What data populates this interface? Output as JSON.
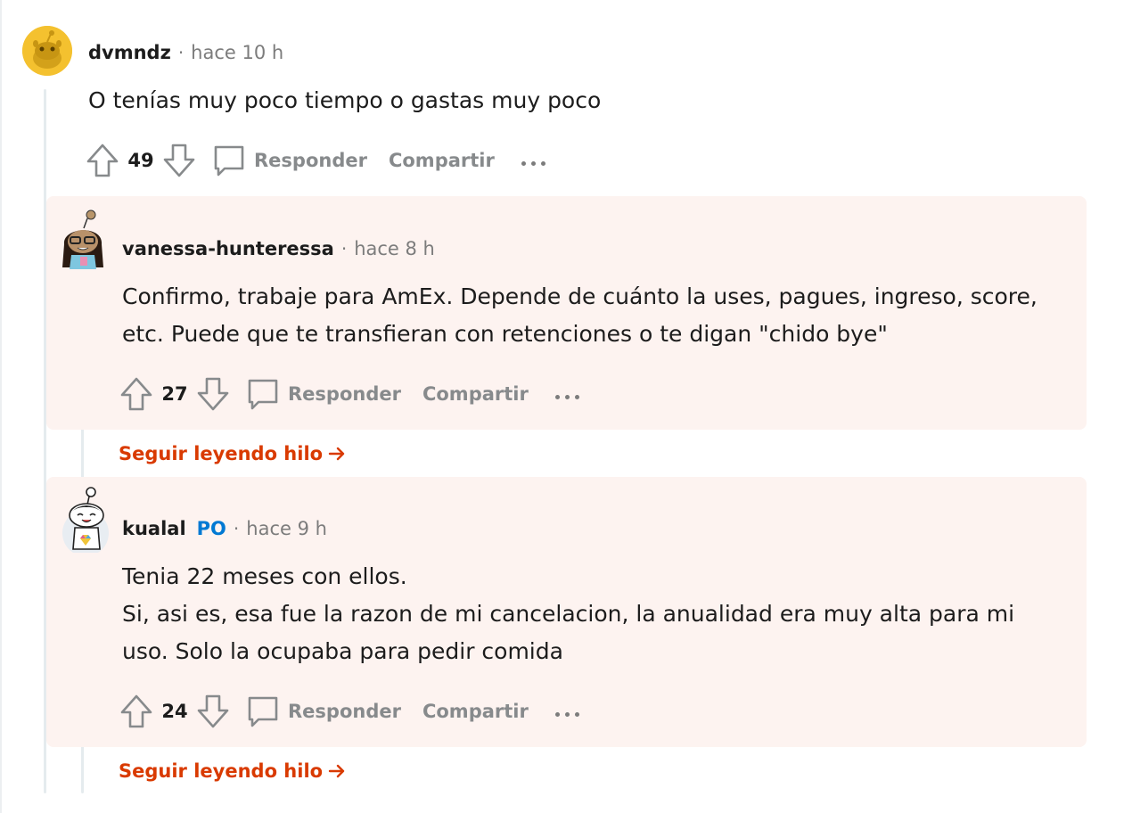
{
  "comments": [
    {
      "username": "dvmndz",
      "time": "hace 10 h",
      "body": [
        "O tenías muy poco tiempo o gastas muy poco"
      ],
      "score": "49"
    },
    {
      "username": "vanessa-hunteressa",
      "time": "hace 8 h",
      "body": [
        "Confirmo, trabaje para AmEx. Depende de cuánto la uses, pagues, ingreso, score,",
        "etc. Puede que te transfieran con retenciones o te digan \"chido bye\""
      ],
      "score": "27",
      "continue_label": "Seguir leyendo hilo"
    },
    {
      "username": "kualal",
      "op_badge": "PO",
      "time": "hace 9 h",
      "body": [
        "Tenia 22 meses con ellos.",
        "Si, asi es, esa fue la razon de mi cancelacion, la anualidad era muy alta para mi",
        "uso. Solo la ocupaba para pedir comida"
      ],
      "score": "24",
      "continue_label": "Seguir leyendo hilo"
    }
  ],
  "actions": {
    "reply_label": "Responder",
    "share_label": "Compartir"
  },
  "colors": {
    "accent": "#d93a00",
    "op_badge": "#0079d3",
    "reply_bg": "#fdf3f0",
    "muted": "#878a8c"
  }
}
